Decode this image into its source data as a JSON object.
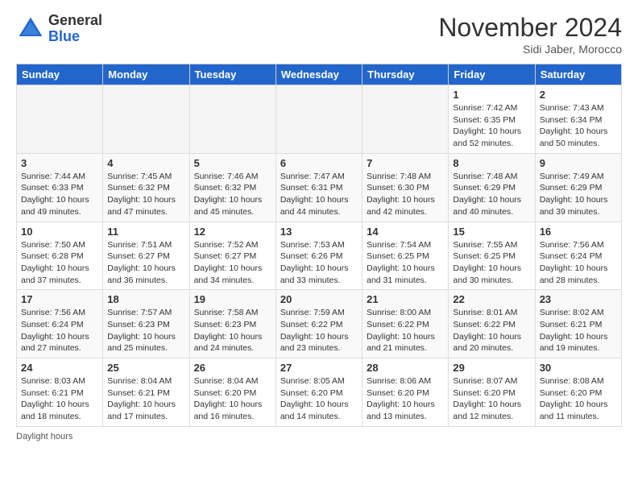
{
  "header": {
    "logo_general": "General",
    "logo_blue": "Blue",
    "month_title": "November 2024",
    "subtitle": "Sidi Jaber, Morocco"
  },
  "footer": {
    "daylight_note": "Daylight hours"
  },
  "days_of_week": [
    "Sunday",
    "Monday",
    "Tuesday",
    "Wednesday",
    "Thursday",
    "Friday",
    "Saturday"
  ],
  "weeks": [
    [
      {
        "day": "",
        "info": ""
      },
      {
        "day": "",
        "info": ""
      },
      {
        "day": "",
        "info": ""
      },
      {
        "day": "",
        "info": ""
      },
      {
        "day": "",
        "info": ""
      },
      {
        "day": "1",
        "info": "Sunrise: 7:42 AM\nSunset: 6:35 PM\nDaylight: 10 hours and 52 minutes."
      },
      {
        "day": "2",
        "info": "Sunrise: 7:43 AM\nSunset: 6:34 PM\nDaylight: 10 hours and 50 minutes."
      }
    ],
    [
      {
        "day": "3",
        "info": "Sunrise: 7:44 AM\nSunset: 6:33 PM\nDaylight: 10 hours and 49 minutes."
      },
      {
        "day": "4",
        "info": "Sunrise: 7:45 AM\nSunset: 6:32 PM\nDaylight: 10 hours and 47 minutes."
      },
      {
        "day": "5",
        "info": "Sunrise: 7:46 AM\nSunset: 6:32 PM\nDaylight: 10 hours and 45 minutes."
      },
      {
        "day": "6",
        "info": "Sunrise: 7:47 AM\nSunset: 6:31 PM\nDaylight: 10 hours and 44 minutes."
      },
      {
        "day": "7",
        "info": "Sunrise: 7:48 AM\nSunset: 6:30 PM\nDaylight: 10 hours and 42 minutes."
      },
      {
        "day": "8",
        "info": "Sunrise: 7:48 AM\nSunset: 6:29 PM\nDaylight: 10 hours and 40 minutes."
      },
      {
        "day": "9",
        "info": "Sunrise: 7:49 AM\nSunset: 6:29 PM\nDaylight: 10 hours and 39 minutes."
      }
    ],
    [
      {
        "day": "10",
        "info": "Sunrise: 7:50 AM\nSunset: 6:28 PM\nDaylight: 10 hours and 37 minutes."
      },
      {
        "day": "11",
        "info": "Sunrise: 7:51 AM\nSunset: 6:27 PM\nDaylight: 10 hours and 36 minutes."
      },
      {
        "day": "12",
        "info": "Sunrise: 7:52 AM\nSunset: 6:27 PM\nDaylight: 10 hours and 34 minutes."
      },
      {
        "day": "13",
        "info": "Sunrise: 7:53 AM\nSunset: 6:26 PM\nDaylight: 10 hours and 33 minutes."
      },
      {
        "day": "14",
        "info": "Sunrise: 7:54 AM\nSunset: 6:25 PM\nDaylight: 10 hours and 31 minutes."
      },
      {
        "day": "15",
        "info": "Sunrise: 7:55 AM\nSunset: 6:25 PM\nDaylight: 10 hours and 30 minutes."
      },
      {
        "day": "16",
        "info": "Sunrise: 7:56 AM\nSunset: 6:24 PM\nDaylight: 10 hours and 28 minutes."
      }
    ],
    [
      {
        "day": "17",
        "info": "Sunrise: 7:56 AM\nSunset: 6:24 PM\nDaylight: 10 hours and 27 minutes."
      },
      {
        "day": "18",
        "info": "Sunrise: 7:57 AM\nSunset: 6:23 PM\nDaylight: 10 hours and 25 minutes."
      },
      {
        "day": "19",
        "info": "Sunrise: 7:58 AM\nSunset: 6:23 PM\nDaylight: 10 hours and 24 minutes."
      },
      {
        "day": "20",
        "info": "Sunrise: 7:59 AM\nSunset: 6:22 PM\nDaylight: 10 hours and 23 minutes."
      },
      {
        "day": "21",
        "info": "Sunrise: 8:00 AM\nSunset: 6:22 PM\nDaylight: 10 hours and 21 minutes."
      },
      {
        "day": "22",
        "info": "Sunrise: 8:01 AM\nSunset: 6:22 PM\nDaylight: 10 hours and 20 minutes."
      },
      {
        "day": "23",
        "info": "Sunrise: 8:02 AM\nSunset: 6:21 PM\nDaylight: 10 hours and 19 minutes."
      }
    ],
    [
      {
        "day": "24",
        "info": "Sunrise: 8:03 AM\nSunset: 6:21 PM\nDaylight: 10 hours and 18 minutes."
      },
      {
        "day": "25",
        "info": "Sunrise: 8:04 AM\nSunset: 6:21 PM\nDaylight: 10 hours and 17 minutes."
      },
      {
        "day": "26",
        "info": "Sunrise: 8:04 AM\nSunset: 6:20 PM\nDaylight: 10 hours and 16 minutes."
      },
      {
        "day": "27",
        "info": "Sunrise: 8:05 AM\nSunset: 6:20 PM\nDaylight: 10 hours and 14 minutes."
      },
      {
        "day": "28",
        "info": "Sunrise: 8:06 AM\nSunset: 6:20 PM\nDaylight: 10 hours and 13 minutes."
      },
      {
        "day": "29",
        "info": "Sunrise: 8:07 AM\nSunset: 6:20 PM\nDaylight: 10 hours and 12 minutes."
      },
      {
        "day": "30",
        "info": "Sunrise: 8:08 AM\nSunset: 6:20 PM\nDaylight: 10 hours and 11 minutes."
      }
    ]
  ]
}
